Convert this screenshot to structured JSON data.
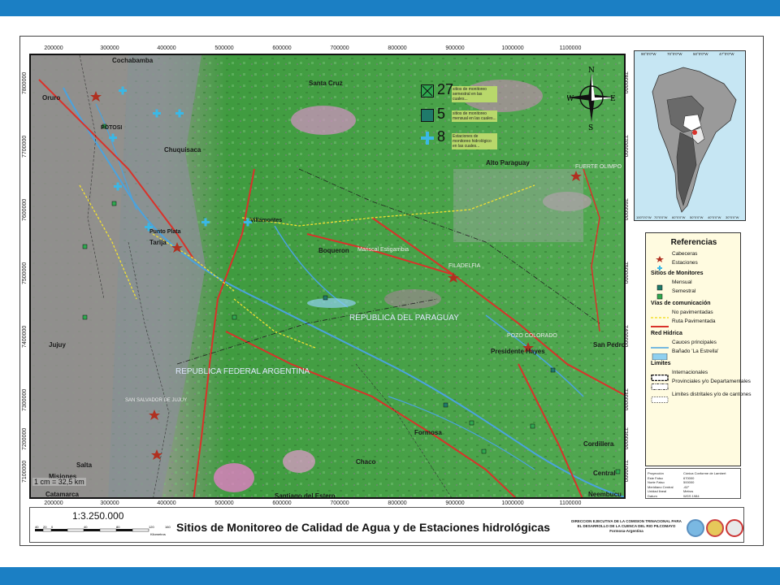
{
  "map": {
    "top_coords": [
      "200000",
      "300000",
      "400000",
      "500000",
      "600000",
      "700000",
      "800000",
      "900000",
      "1000000",
      "1100000"
    ],
    "bottom_coords": [
      "200000",
      "300000",
      "400000",
      "500000",
      "600000",
      "700000",
      "800000",
      "900000",
      "1000000",
      "1100000"
    ],
    "right_coords": [
      "7800000",
      "7700000",
      "7600000",
      "7500000",
      "7400000",
      "7300000",
      "7200000",
      "7100000"
    ],
    "left_coords": [
      "7800000",
      "7700000",
      "7600000",
      "7500000",
      "7400000",
      "7300000",
      "7200000",
      "7100000"
    ],
    "places": {
      "cochabamba": "Cochabamba",
      "oruro": "Oruro",
      "santa_cruz": "Santa Cruz",
      "chuquisaca": "Chuquisaca",
      "potosi": "POTOSI",
      "tarija": "Tarija",
      "alto_paraguay": "Alto Paraguay",
      "fuerte_olimpo": "FUERTE OLIMPO",
      "boqueron": "Boqueron",
      "filadelfia": "FILADELFIA",
      "mariscal": "Mariscal Estigarribia",
      "republica_paraguay": "REPUBLICA DEL PARAGUAY",
      "republica_argentina": "REPUBLICA FEDERAL ARGENTINA",
      "jujuy": "Jujuy",
      "salta": "Salta",
      "presidente_hayes": "Presidente Hayes",
      "pozo_colorado": "POZO COLORADO",
      "san_pedro": "San Pedro",
      "formosa": "Formosa",
      "chaco": "Chaco",
      "santiago": "Santiago del Estero",
      "catamarca": "Catamarca",
      "cordillera": "Cordillera",
      "central": "Central",
      "neembucu": "Neembucu",
      "misiones": "Misiones",
      "villamontes": "Villamontes",
      "san_salvador": "SAN SALVADOR DE JUJUY",
      "punto_plata": "Punto Plata"
    },
    "scale_note": "1 cm = 32,5 km"
  },
  "summary": [
    {
      "number": "27",
      "text": "sitios de monitoreo semestral en las cuales...",
      "color": "#2fa84f"
    },
    {
      "number": "5",
      "text": "sitios de monitoreo mensual en las cuales...",
      "color": "#1f7a6a"
    },
    {
      "number": "8",
      "text": "Estaciones de monitoreo hidrológico en las cuales...",
      "color": "#3ab8e6"
    }
  ],
  "compass": {
    "n": "N",
    "s": "S",
    "e": "E",
    "w": "W"
  },
  "inset": {
    "top_coords": [
      "90°0'0\"W",
      "70°0'0\"W",
      "50°0'0\"W",
      "47°0'0\"W"
    ],
    "bottom_coords": [
      "100°0'0\"W",
      "70°0'0\"W",
      "60°0'0\"W",
      "50°0'0\"W",
      "40°0'0\"W",
      "30°0'0\"W"
    ]
  },
  "legend": {
    "title": "Referencias",
    "items": [
      {
        "label": "Cabeceras",
        "symbol": "star"
      },
      {
        "label": "Estaciones",
        "symbol": "cross"
      }
    ],
    "monitor_head": "Sitios de Monitores",
    "monitor_items": [
      {
        "label": "Mensual",
        "symbol": "square-teal"
      },
      {
        "label": "Semestral",
        "symbol": "square-green"
      }
    ],
    "roads_head": "Vías de comunicación",
    "road_items": [
      {
        "label": "No pavimentadas",
        "symbol": "line-yellow"
      },
      {
        "label": "Ruta Pavimentada",
        "symbol": "line-red"
      }
    ],
    "water_head": "Red Hídrica",
    "water_items": [
      {
        "label": "Cauces principales",
        "symbol": "line-blue"
      },
      {
        "label": "Bañado 'La Estrella'",
        "symbol": "area-blue"
      }
    ],
    "limits_head": "Limites",
    "limit_items": [
      {
        "label": "Internacionales",
        "symbol": "dash-thick"
      },
      {
        "label": "Provinciales y/o Departamentales",
        "symbol": "dash-med"
      },
      {
        "label": "Limites distritales y/o de cantones",
        "symbol": "dash-thin"
      }
    ]
  },
  "projection": [
    {
      "k": "Proyección",
      "v": "Cónica Conforme de Lambert"
    },
    {
      "k": "Este Falso",
      "v": "670000"
    },
    {
      "k": "Norte Falso",
      "v": "500000"
    },
    {
      "k": "Meridiano Central",
      "v": "-62°"
    },
    {
      "k": "Unidad lineal",
      "v": "Metros"
    },
    {
      "k": "Datum",
      "v": "WGS 1984"
    }
  ],
  "footer": {
    "scale": "1:3.250.000",
    "scale_ticks": [
      "40",
      "20",
      "0",
      "40",
      "80",
      "120",
      "160"
    ],
    "scale_unit": "Kilometros",
    "title": "Sitios de Monitoreo de Calidad de Agua y de Estaciones hidrológicas",
    "institution": "DIRECCION EJECUTIVA DE LA COMISION TRINACIONAL PARA EL DESARROLLO DE LA CUENCA DEL RIO PILCOMAYO",
    "institution_loc": "Formosa-Argentina"
  },
  "colors": {
    "bar": "#1b7fc4",
    "road_paved": "#d9322a",
    "road_unpaved": "#f2e030",
    "river": "#4aa3df"
  }
}
